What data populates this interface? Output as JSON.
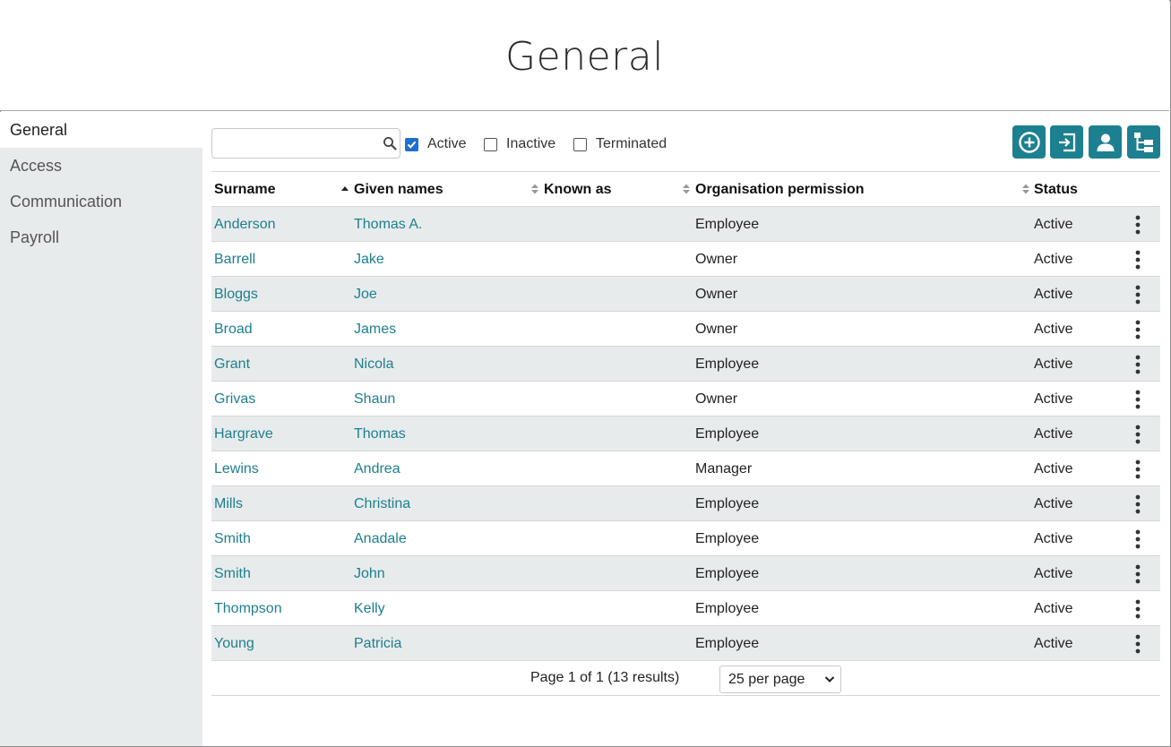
{
  "header": {
    "title": "General"
  },
  "sidebar": {
    "items": [
      {
        "label": "General",
        "active": true
      },
      {
        "label": "Access",
        "active": false
      },
      {
        "label": "Communication",
        "active": false
      },
      {
        "label": "Payroll",
        "active": false
      }
    ]
  },
  "search": {
    "value": "",
    "placeholder": "",
    "icon": "search-icon"
  },
  "filters": [
    {
      "label": "Active",
      "checked": true
    },
    {
      "label": "Inactive",
      "checked": false
    },
    {
      "label": "Terminated",
      "checked": false
    }
  ],
  "toolbar": {
    "buttons": [
      {
        "icon": "add-circle-icon"
      },
      {
        "icon": "import-icon"
      },
      {
        "icon": "person-icon"
      },
      {
        "icon": "org-chart-icon"
      }
    ],
    "accent_color": "#1d8090"
  },
  "table": {
    "columns": [
      {
        "label": "Surname",
        "sort": "none"
      },
      {
        "label": "Given names",
        "sort": "ascending"
      },
      {
        "label": "Known as",
        "sort": "unsorted"
      },
      {
        "label": "Organisation permission",
        "sort": "unsorted"
      },
      {
        "label": "Status",
        "sort": "unsorted"
      }
    ],
    "rows": [
      {
        "surname": "Anderson",
        "given": "Thomas A.",
        "known": "",
        "permission": "Employee",
        "status": "Active"
      },
      {
        "surname": "Barrell",
        "given": "Jake",
        "known": "",
        "permission": "Owner",
        "status": "Active"
      },
      {
        "surname": "Bloggs",
        "given": "Joe",
        "known": "",
        "permission": "Owner",
        "status": "Active"
      },
      {
        "surname": "Broad",
        "given": "James",
        "known": "",
        "permission": "Owner",
        "status": "Active"
      },
      {
        "surname": "Grant",
        "given": "Nicola",
        "known": "",
        "permission": "Employee",
        "status": "Active"
      },
      {
        "surname": "Grivas",
        "given": "Shaun",
        "known": "",
        "permission": "Owner",
        "status": "Active"
      },
      {
        "surname": "Hargrave",
        "given": "Thomas",
        "known": "",
        "permission": "Employee",
        "status": "Active"
      },
      {
        "surname": "Lewins",
        "given": "Andrea",
        "known": "",
        "permission": "Manager",
        "status": "Active"
      },
      {
        "surname": "Mills",
        "given": "Christina",
        "known": "",
        "permission": "Employee",
        "status": "Active"
      },
      {
        "surname": "Smith",
        "given": "Anadale",
        "known": "",
        "permission": "Employee",
        "status": "Active"
      },
      {
        "surname": "Smith",
        "given": "John",
        "known": "",
        "permission": "Employee",
        "status": "Active"
      },
      {
        "surname": "Thompson",
        "given": "Kelly",
        "known": "",
        "permission": "Employee",
        "status": "Active"
      },
      {
        "surname": "Young",
        "given": "Patricia",
        "known": "",
        "permission": "Employee",
        "status": "Active"
      }
    ],
    "row_menu_icon": "kebab-menu-icon"
  },
  "pagination": {
    "text": "Page 1 of 1 (13 results)",
    "per_page": "25 per page"
  }
}
